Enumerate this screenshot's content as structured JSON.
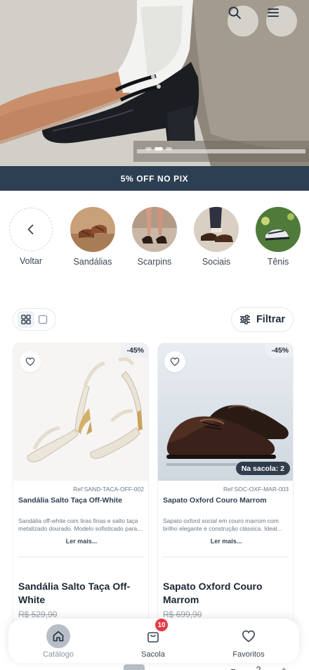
{
  "hero": {
    "search_icon": "search-icon",
    "menu_icon": "menu-icon",
    "slides": 3,
    "active_slide": 2
  },
  "promo": {
    "text": "5% OFF NO PIX"
  },
  "categories": [
    {
      "label": "Voltar",
      "icon": "chevron-left-icon"
    },
    {
      "label": "Sandálias"
    },
    {
      "label": "Scarpins"
    },
    {
      "label": "Sociais"
    },
    {
      "label": "Tênis"
    }
  ],
  "toolbar": {
    "view_grid_icon": "grid-icon",
    "view_single_icon": "square-icon",
    "filter_label": "Filtrar",
    "filter_icon": "sliders-icon"
  },
  "products": [
    {
      "discount": "-45%",
      "ref": "Ref SAND-TACA-OFF-002",
      "title_small": "Sandália Salto Taça Off-White",
      "description": "Sandália off-white com tiras finas e salto taça metalizado dourado. Modelo sofisticado para...",
      "more": "Ler mais...",
      "title": "Sandália Salto Taça Off-White",
      "old_price": "R$ 529,90"
    },
    {
      "discount": "-45%",
      "bag_tag": "Na sacola: 2",
      "ref": "Ref SOC-OXF-MAR-003",
      "title_small": "Sapato Oxford Couro Marrom",
      "description": "Sapato oxford social em couro marrom com brilho elegante e construção clássica. Ideal...",
      "more": "Ler mais...",
      "title": "Sapato Oxford Couro Marrom",
      "old_price": "R$ 699,90"
    }
  ],
  "bottom_nav": {
    "items": [
      {
        "label": "Catálogo",
        "icon": "home-icon"
      },
      {
        "label": "Sacola",
        "icon": "shopping-bag-icon",
        "badge": "10"
      },
      {
        "label": "Favoritos",
        "icon": "heart-icon"
      }
    ]
  },
  "peek": {
    "minus": "−",
    "qty": "2",
    "plus": "+"
  },
  "colors": {
    "promo_bg": "#2d3f53",
    "badge_red": "#e53946",
    "text_dark": "#1f2d3d"
  }
}
